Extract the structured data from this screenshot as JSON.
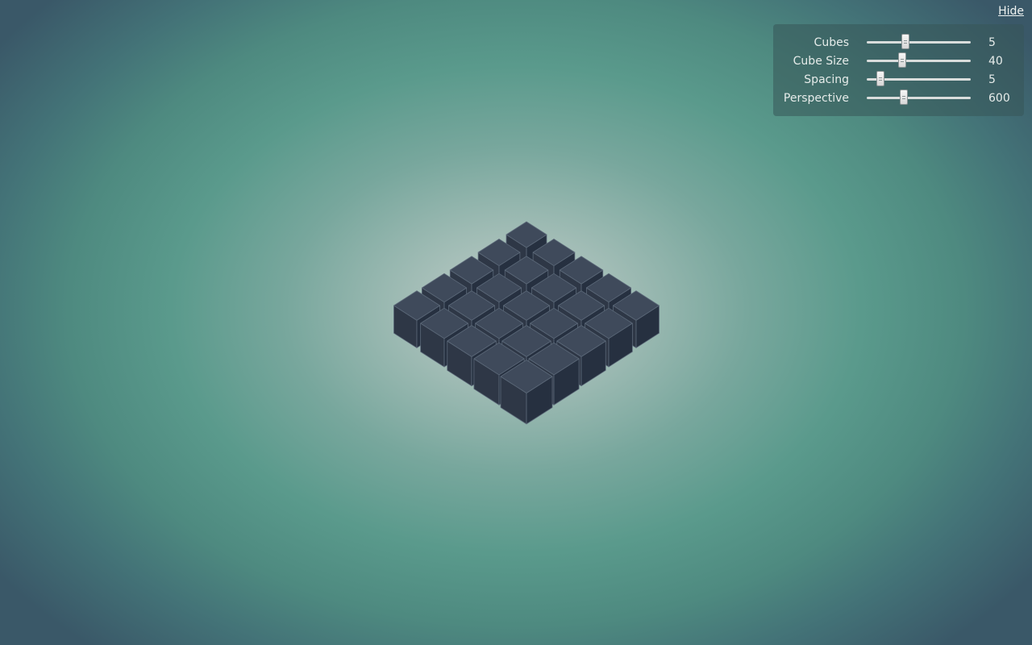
{
  "controls": {
    "hide_label": "Hide",
    "sliders": [
      {
        "label": "Cubes",
        "value": "5",
        "fraction": 0.37
      },
      {
        "label": "Cube Size",
        "value": "40",
        "fraction": 0.34
      },
      {
        "label": "Spacing",
        "value": "5",
        "fraction": 0.13
      },
      {
        "label": "Perspective",
        "value": "600",
        "fraction": 0.36
      }
    ]
  },
  "scene": {
    "grid_count": 5,
    "colors": {
      "top": "#3f4a5b",
      "left": "#2e3746",
      "right": "#263040",
      "edge": "#5b6878"
    }
  }
}
